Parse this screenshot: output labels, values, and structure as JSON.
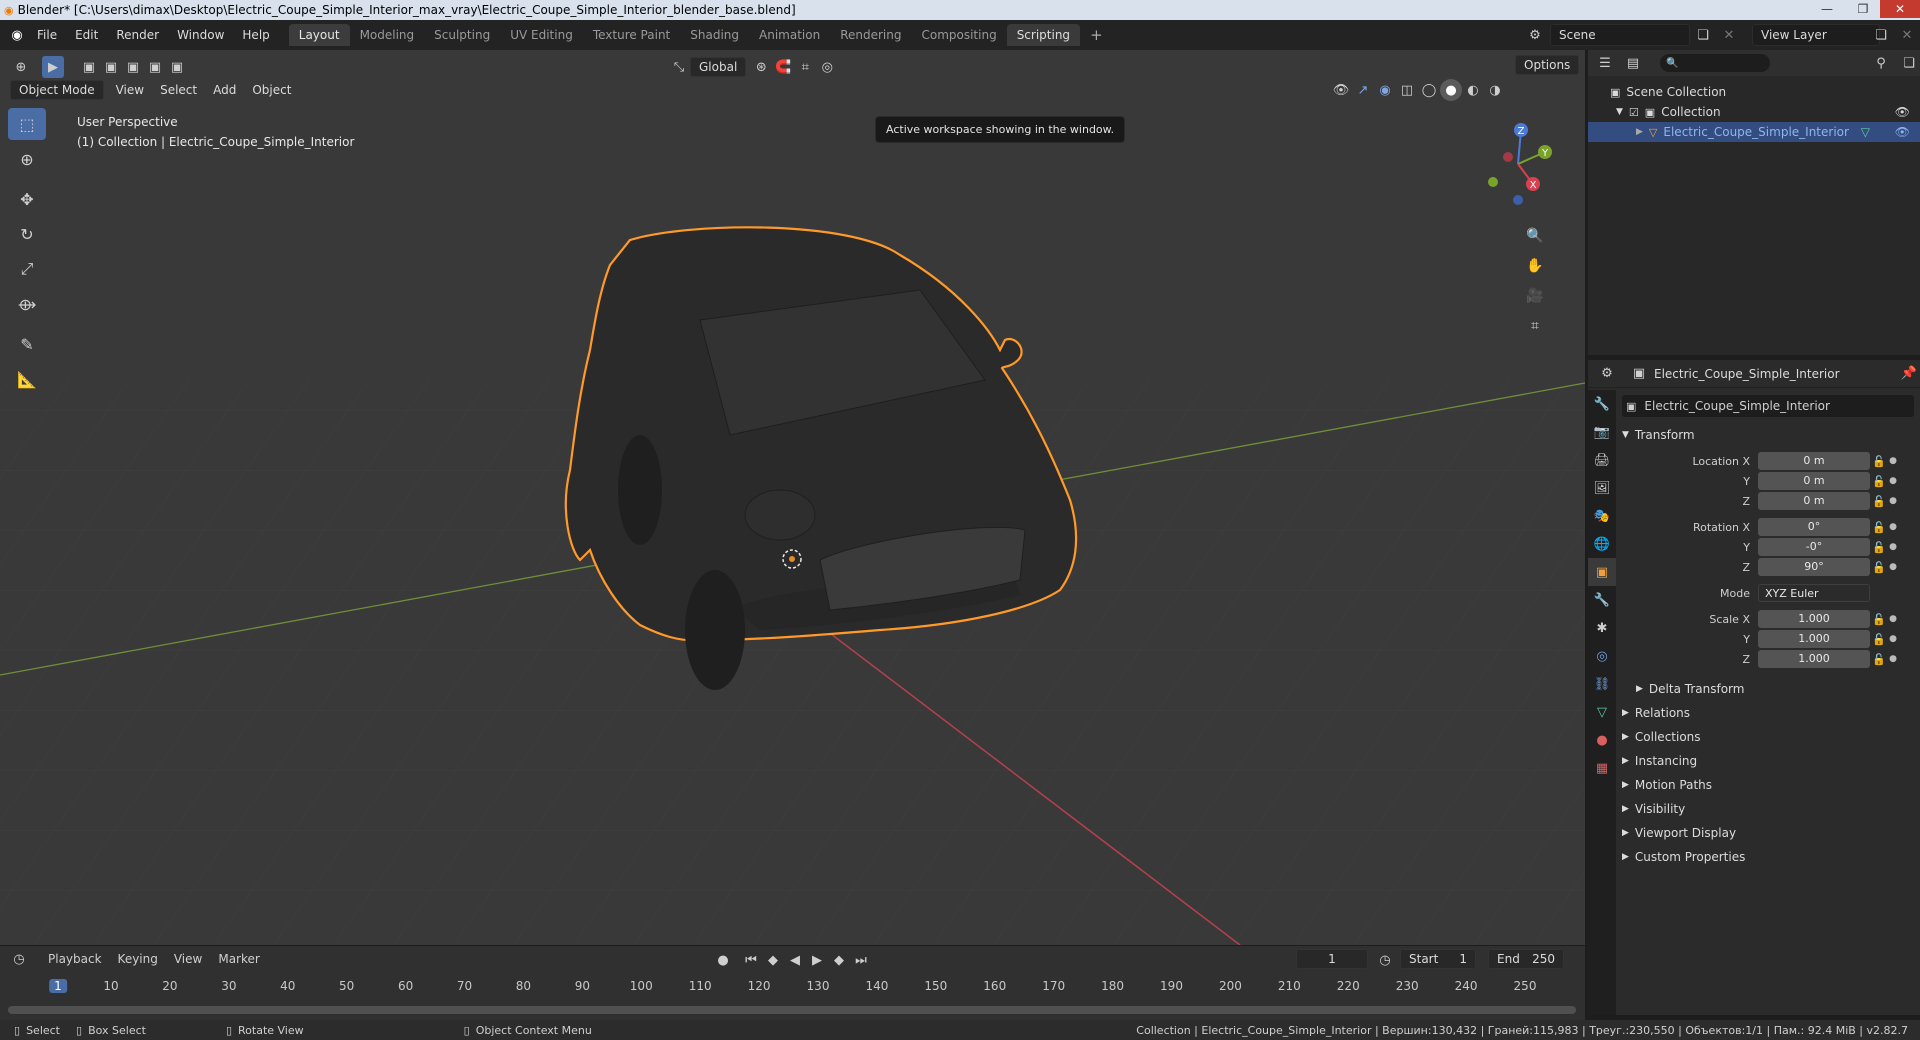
{
  "window": {
    "title": "Blender* [C:\\Users\\dimax\\Desktop\\Electric_Coupe_Simple_Interior_max_vray\\Electric_Coupe_Simple_Interior_blender_base.blend]",
    "minimize": "—",
    "maximize": "❐",
    "close": "✕"
  },
  "menus": [
    "File",
    "Edit",
    "Render",
    "Window",
    "Help"
  ],
  "workspaces": [
    "Layout",
    "Modeling",
    "Sculpting",
    "UV Editing",
    "Texture Paint",
    "Shading",
    "Animation",
    "Rendering",
    "Compositing",
    "Scripting"
  ],
  "workspace_plus": "+",
  "scene": {
    "label": "Scene",
    "view_layer": "View Layer"
  },
  "viewport": {
    "mode": "Object Mode",
    "menus": [
      "View",
      "Select",
      "Add",
      "Object"
    ],
    "orientation": "Global",
    "options": "Options",
    "tooltip": "Active workspace showing in the window.",
    "info_line1": "User Perspective",
    "info_line2": "(1) Collection | Electric_Coupe_Simple_Interior",
    "gizmo_axes": {
      "z": "Z",
      "y": "Y",
      "x": "X"
    }
  },
  "outliner": {
    "rows": [
      {
        "label": "Scene Collection"
      },
      {
        "label": "Collection"
      },
      {
        "label": "Electric_Coupe_Simple_Interior"
      }
    ]
  },
  "properties": {
    "header": "Electric_Coupe_Simple_Interior",
    "object_name": "Electric_Coupe_Simple_Interior",
    "transform_label": "Transform",
    "fields": [
      {
        "label": "Location X",
        "value": "0 m"
      },
      {
        "label": "Y",
        "value": "0 m"
      },
      {
        "label": "Z",
        "value": "0 m"
      },
      {
        "label": "Rotation X",
        "value": "0°"
      },
      {
        "label": "Y",
        "value": "-0°"
      },
      {
        "label": "Z",
        "value": "90°"
      },
      {
        "label": "Mode",
        "value": "XYZ Euler"
      },
      {
        "label": "Scale X",
        "value": "1.000"
      },
      {
        "label": "Y",
        "value": "1.000"
      },
      {
        "label": "Z",
        "value": "1.000"
      }
    ],
    "delta": "Delta Transform",
    "panels": [
      "Relations",
      "Collections",
      "Instancing",
      "Motion Paths",
      "Visibility",
      "Viewport Display",
      "Custom Properties"
    ]
  },
  "timeline": {
    "menus": [
      "Playback",
      "Keying",
      "View",
      "Marker"
    ],
    "current_frame": "1",
    "start_label": "Start",
    "start": "1",
    "end_label": "End",
    "end": "250",
    "ticks": [
      "1",
      "10",
      "20",
      "30",
      "40",
      "50",
      "60",
      "70",
      "80",
      "90",
      "100",
      "110",
      "120",
      "130",
      "140",
      "150",
      "160",
      "170",
      "180",
      "190",
      "200",
      "210",
      "220",
      "230",
      "240",
      "250"
    ]
  },
  "statusbar": {
    "select": "Select",
    "box_select": "Box Select",
    "rotate": "Rotate View",
    "context": "Object Context Menu",
    "stats": "Collection | Electric_Coupe_Simple_Interior | Вершин:130,432 | Граней:115,983 | Треуг.:230,550 | Объектов:1/1 | Пам.: 92.4 MiB | v2.82.7"
  },
  "colors": {
    "accent": "#4b6da6",
    "select_outline": "#ff9a2a",
    "x_axis": "#b6404e",
    "y_axis": "#6e8f3a"
  }
}
